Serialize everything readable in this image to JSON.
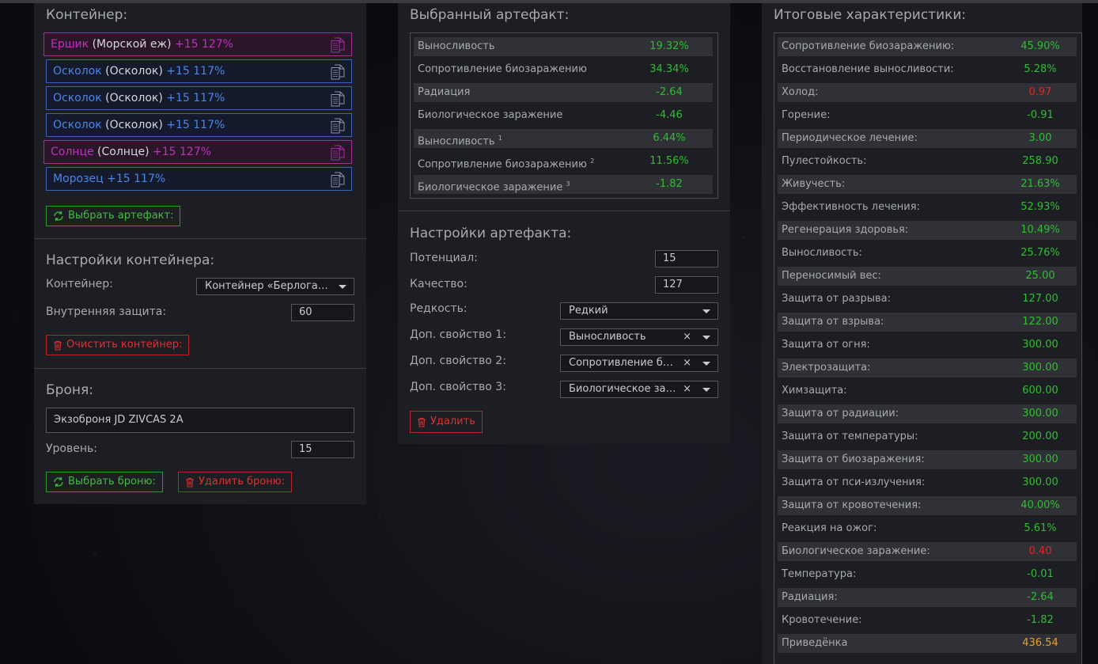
{
  "container_panel": {
    "title": "Контейнер:",
    "items": [
      {
        "name": "Ершик",
        "base": "(Морской еж)",
        "level": "+15 127%",
        "rarity": "purple"
      },
      {
        "name": "Осколок",
        "base": "(Осколок)",
        "level": "+15 117%",
        "rarity": "blue"
      },
      {
        "name": "Осколок",
        "base": "(Осколок)",
        "level": "+15 117%",
        "rarity": "blue"
      },
      {
        "name": "Осколок",
        "base": "(Осколок)",
        "level": "+15 117%",
        "rarity": "blue"
      },
      {
        "name": "Солнце",
        "base": "(Солнце)",
        "level": "+15 127%",
        "rarity": "purple"
      },
      {
        "name": "Морозец",
        "base": "",
        "level": "+15 117%",
        "rarity": "blue"
      }
    ],
    "select_artifact_button": "Выбрать артефакт:",
    "settings_title": "Настройки контейнера:",
    "container_label": "Контейнер:",
    "container_value": "Контейнер «Берлога…",
    "internal_protection_label": "Внутренняя защита:",
    "internal_protection_value": "60",
    "clear_button": "Очистить контейнер:",
    "armor_title": "Броня:",
    "armor_value": "Экзоброня JD ZIVCAS 2A",
    "level_label": "Уровень:",
    "level_value": "15",
    "select_armor_button": "Выбрать броню:",
    "delete_armor_button": "Удалить броню:"
  },
  "artifact_panel": {
    "title": "Выбранный артефакт:",
    "stats": [
      {
        "name": "Выносливость",
        "sup": "",
        "value": "19.32%",
        "color": "green"
      },
      {
        "name": "Сопротивление биозаражению",
        "sup": "",
        "value": "34.34%",
        "color": "green"
      },
      {
        "name": "Радиация",
        "sup": "",
        "value": "-2.64",
        "color": "green"
      },
      {
        "name": "Биологическое заражение",
        "sup": "",
        "value": "-4.46",
        "color": "green"
      },
      {
        "name": "Выносливость",
        "sup": "1",
        "value": "6.44%",
        "color": "green"
      },
      {
        "name": "Сопротивление биозаражению",
        "sup": "2",
        "value": "11.56%",
        "color": "green"
      },
      {
        "name": "Биологическое заражение",
        "sup": "3",
        "value": "-1.82",
        "color": "green"
      }
    ],
    "settings_title": "Настройки артефакта:",
    "potential_label": "Потенциал:",
    "potential_value": "15",
    "quality_label": "Качество:",
    "quality_value": "127",
    "rarity_label": "Редкость:",
    "rarity_value": "Редкий",
    "prop1_label": "Доп. свойство 1:",
    "prop1_value": "Выносливость",
    "prop2_label": "Доп. свойство 2:",
    "prop2_value": "Сопротивление б…",
    "prop3_label": "Доп. свойство 3:",
    "prop3_value": "Биологическое за…",
    "clear_symbol": "×",
    "delete_button": "Удалить"
  },
  "totals_panel": {
    "title": "Итоговые характеристики:",
    "stats": [
      {
        "name": "Сопротивление биозаражению:",
        "value": "45.90%",
        "color": "green"
      },
      {
        "name": "Восстановление выносливости:",
        "value": "5.28%",
        "color": "green"
      },
      {
        "name": "Холод:",
        "value": "0.97",
        "color": "red"
      },
      {
        "name": "Горение:",
        "value": "-0.91",
        "color": "green"
      },
      {
        "name": "Периодическое лечение:",
        "value": "3.00",
        "color": "green"
      },
      {
        "name": "Пулестойкость:",
        "value": "258.90",
        "color": "green"
      },
      {
        "name": "Живучесть:",
        "value": "21.63%",
        "color": "green"
      },
      {
        "name": "Эффективность лечения:",
        "value": "52.93%",
        "color": "green"
      },
      {
        "name": "Регенерация здоровья:",
        "value": "10.49%",
        "color": "green"
      },
      {
        "name": "Выносливость:",
        "value": "25.76%",
        "color": "green"
      },
      {
        "name": "Переносимый вес:",
        "value": "25.00",
        "color": "green"
      },
      {
        "name": "Защита от разрыва:",
        "value": "127.00",
        "color": "green"
      },
      {
        "name": "Защита от взрыва:",
        "value": "122.00",
        "color": "green"
      },
      {
        "name": "Защита от огня:",
        "value": "300.00",
        "color": "green"
      },
      {
        "name": "Электрозащита:",
        "value": "300.00",
        "color": "green"
      },
      {
        "name": "Химзащита:",
        "value": "600.00",
        "color": "green"
      },
      {
        "name": "Защита от радиации:",
        "value": "300.00",
        "color": "green"
      },
      {
        "name": "Защита от температуры:",
        "value": "200.00",
        "color": "green"
      },
      {
        "name": "Защита от биозаражения:",
        "value": "300.00",
        "color": "green"
      },
      {
        "name": "Защита от пси-излучения:",
        "value": "300.00",
        "color": "green"
      },
      {
        "name": "Защита от кровотечения:",
        "value": "40.00%",
        "color": "green"
      },
      {
        "name": "Реакция на ожог:",
        "value": "5.61%",
        "color": "green"
      },
      {
        "name": "Биологическое заражение:",
        "value": "0.40",
        "color": "red"
      },
      {
        "name": "Температура:",
        "value": "-0.01",
        "color": "green"
      },
      {
        "name": "Радиация:",
        "value": "-2.64",
        "color": "green"
      },
      {
        "name": "Кровотечение:",
        "value": "-1.82",
        "color": "green"
      },
      {
        "name": "Приведёнка",
        "value": "436.54",
        "color": "orange"
      }
    ]
  },
  "colors": {
    "green": "#2fbf2f",
    "red": "#e02828",
    "orange": "#f0a020",
    "blue_rarity": "#4a86e8",
    "purple_rarity": "#c02ec0",
    "panel_bg": "#1c1e23",
    "page_bg": "#0b0c10"
  }
}
